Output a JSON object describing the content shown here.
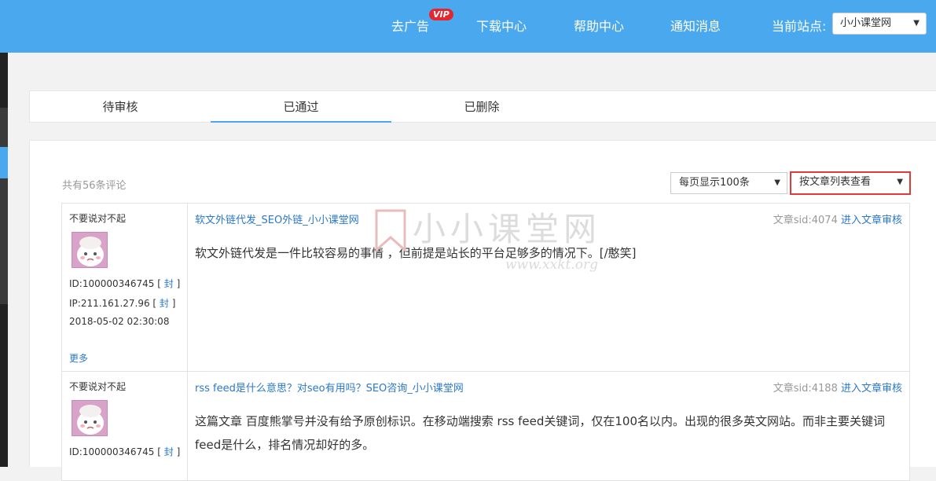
{
  "header": {
    "nav": [
      {
        "label": "去广告",
        "badge": "VIP"
      },
      {
        "label": "下载中心"
      },
      {
        "label": "帮助中心"
      },
      {
        "label": "通知消息"
      }
    ],
    "site_label": "当前站点:",
    "site_value": "小小课堂网"
  },
  "tabs": [
    {
      "label": "待审核",
      "active": false
    },
    {
      "label": "已通过",
      "active": true
    },
    {
      "label": "已删除",
      "active": false
    }
  ],
  "toolbar": {
    "count_text": "共有56条评论",
    "per_page": "每页显示100条",
    "view_mode": "按文章列表查看"
  },
  "comments": [
    {
      "user": "不要说对不起",
      "id": "ID:100000346745",
      "ip": "IP:211.161.27.96",
      "ban": "封",
      "time": "2018-05-02 02:30:08",
      "more": "更多",
      "title": "软文外链代发_SEO外链_小小课堂网",
      "sid": "文章sid:4074",
      "enter": "进入文章审核",
      "content": "软文外链代发是一件比较容易的事情 ，但前提是站长的平台足够多的情况下。[/憨笑]"
    },
    {
      "user": "不要说对不起",
      "id": "ID:100000346745",
      "ban": "封",
      "title": "rss feed是什么意思？对seo有用吗？SEO咨询_小小课堂网",
      "sid": "文章sid:4188",
      "enter": "进入文章审核",
      "content": "这篇文章 百度熊掌号并没有给予原创标识。在移动端搜索 rss feed关键词，仅在100名以内。出现的很多英文网站。而非主要关键词feed是什么，排名情况却好的多。"
    }
  ],
  "watermark": {
    "brand": "小小课堂网",
    "url": "www.xxkt.org"
  },
  "colors": {
    "header": "#4aa8ef",
    "link": "#2a78c9",
    "vip": "#e5262e",
    "highlight_border": "#e03b3b"
  }
}
